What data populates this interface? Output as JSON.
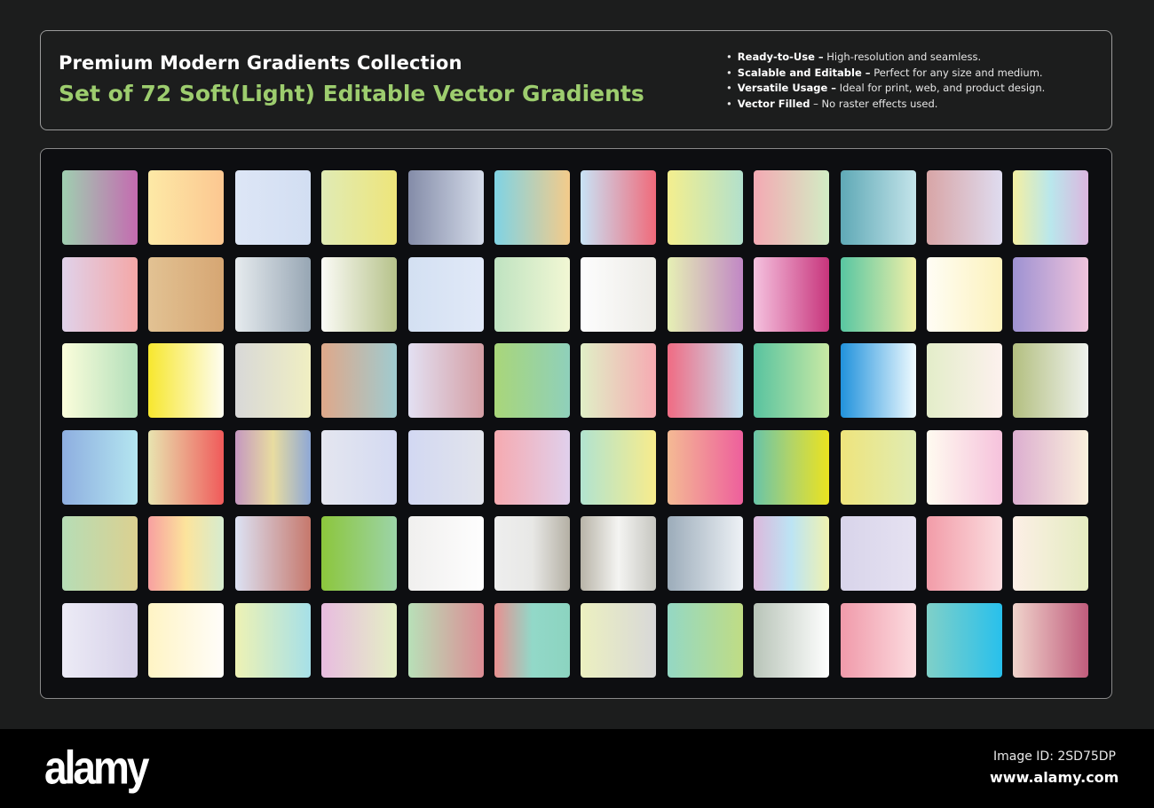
{
  "header": {
    "title": "Premium Modern Gradients Collection",
    "subtitle": "Set of 72 Soft(Light) Editable Vector Gradients",
    "subtitle_color": "#9dcd6e",
    "features": [
      {
        "label": "Ready-to-Use –",
        "text": " High-resolution and seamless."
      },
      {
        "label": "Scalable and Editable –",
        "text": " Perfect for any size and medium."
      },
      {
        "label": "Versatile Usage –",
        "text": " Ideal for print, web, and product design."
      },
      {
        "label": "Vector Filled",
        "text": " – No raster effects used."
      }
    ]
  },
  "swatches": [
    [
      [
        "#9fcfb0",
        "#c46bb0"
      ],
      [
        "#fde9a6",
        "#fcc791"
      ],
      [
        "#dde6f6",
        "#d2def2"
      ],
      [
        "#e0ebb5",
        "#eee57a"
      ],
      [
        "#848ca8",
        "#d5dcea"
      ],
      [
        "#7fd3e4",
        "#f4cb8a"
      ],
      [
        "#c8e3f6",
        "#f06a7a"
      ],
      [
        "#f4ef8e",
        "#b2e0cc"
      ],
      [
        "#f4a9b3",
        "#d2edc4"
      ],
      [
        "#5fa9b6",
        "#c4e4ea"
      ],
      [
        "#d8a5a6",
        "#dfdcf0"
      ],
      [
        "#f4efa2",
        "#b9e7ec",
        "#dcb6df"
      ]
    ],
    [
      [
        "#e0d2ea",
        "#f4a7a7"
      ],
      [
        "#e2c293",
        "#d6a673"
      ],
      [
        "#e6ebee",
        "#97a6b4"
      ],
      [
        "#fbfbf6",
        "#b6c28a"
      ],
      [
        "#d3e0f2",
        "#e1e9f8"
      ],
      [
        "#bfe3c1",
        "#f2f7d4"
      ],
      [
        "#fdfdfd",
        "#ecebe6"
      ],
      [
        "#e6f0b4",
        "#c187c5"
      ],
      [
        "#f5c2df",
        "#c7357c"
      ],
      [
        "#58c6a2",
        "#f2f0a8"
      ],
      [
        "#fffdf5",
        "#fcf2bc"
      ],
      [
        "#9e92d2",
        "#f0c4dc"
      ]
    ],
    [
      [
        "#fbfddb",
        "#b2dfba"
      ],
      [
        "#f7e72e",
        "#fefdf2"
      ],
      [
        "#d8d8d8",
        "#f0efc2"
      ],
      [
        "#dfa88a",
        "#9fcbd0"
      ],
      [
        "#e3e0f2",
        "#d49ea4"
      ],
      [
        "#a9d679",
        "#8fd0bb"
      ],
      [
        "#e0efc6",
        "#f6aab2"
      ],
      [
        "#f06b83",
        "#c4e4f4"
      ],
      [
        "#58c3a0",
        "#c9e9a4"
      ],
      [
        "#2192dc",
        "#f0fbff"
      ],
      [
        "#e3edc9",
        "#fdf1ee"
      ],
      [
        "#b3bf80",
        "#eff2ee"
      ]
    ],
    [
      [
        "#8eaee0",
        "#b4e6f0"
      ],
      [
        "#e8e4b0",
        "#f05a5a"
      ],
      [
        "#c598c0",
        "#e8dca0",
        "#8ea8d6"
      ],
      [
        "#e4e6ef",
        "#d4daf2"
      ],
      [
        "#d2d8f2",
        "#e2e4ec"
      ],
      [
        "#f6aab0",
        "#e0d0ec"
      ],
      [
        "#b1e3d0",
        "#f8ec8c"
      ],
      [
        "#f4ba94",
        "#ee5f9c"
      ],
      [
        "#68c4a8",
        "#b2d468",
        "#ebe31f"
      ],
      [
        "#eee47c",
        "#e0ecb4"
      ],
      [
        "#fffbf0",
        "#f6c2dc"
      ],
      [
        "#dcaed0",
        "#faf0dc"
      ]
    ],
    [
      [
        "#b6ddb6",
        "#dcd090"
      ],
      [
        "#f8a0a0",
        "#fce49c",
        "#d6ecd0"
      ],
      [
        "#dce2f4",
        "#c6786c"
      ],
      [
        "#8cc63c",
        "#9cd4a8"
      ],
      [
        "#f0efee",
        "#fefefe"
      ],
      [
        "#eeeeee",
        "#e8e8e6",
        "#b4b0a4"
      ],
      [
        "#b8b4a8",
        "#f4f4f2",
        "#c6c6c0"
      ],
      [
        "#9cacba",
        "#eef2f6"
      ],
      [
        "#dcb8dc",
        "#bce4f4",
        "#f0f2b0"
      ],
      [
        "#d8d4ea",
        "#e6e2f2"
      ],
      [
        "#f29ca8",
        "#fbdde0"
      ],
      [
        "#fcefe6",
        "#e4ecc0"
      ]
    ],
    [
      [
        "#ecebf6",
        "#d6d0e8"
      ],
      [
        "#fff4c4",
        "#fffdfa"
      ],
      [
        "#eef2b4",
        "#a6e0e8"
      ],
      [
        "#e8bce0",
        "#e4f0c4"
      ],
      [
        "#b8e0b8",
        "#dc8c94"
      ],
      [
        "#e89090",
        "#92d8c8",
        "#8cd4c0"
      ],
      [
        "#ecf0c0",
        "#d8d8d8"
      ],
      [
        "#94d8c4",
        "#c0dc84"
      ],
      [
        "#b8c4b8",
        "#ffffff"
      ],
      [
        "#f09aaa",
        "#fcdce0"
      ],
      [
        "#80d0c8",
        "#28c0ec"
      ],
      [
        "#f0d4cc",
        "#c05c7c"
      ]
    ]
  ],
  "footer": {
    "logo": "alamy",
    "image_id": "Image ID: 2SD75DP",
    "site": "www.alamy.com"
  }
}
